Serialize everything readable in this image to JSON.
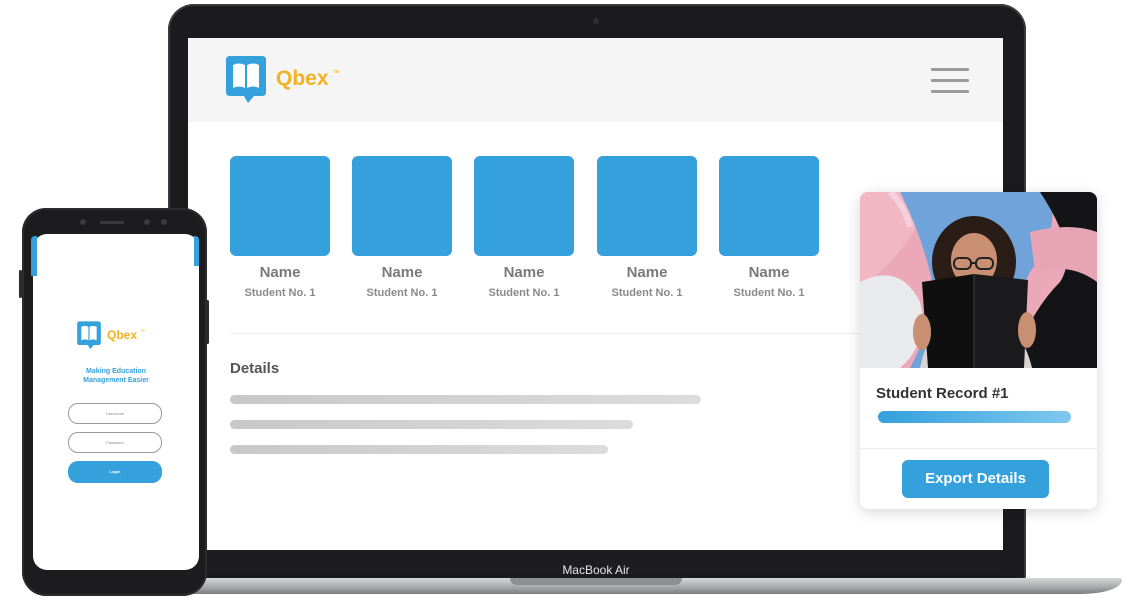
{
  "brand": {
    "name": "Qbex",
    "trademark": "™",
    "accent_color": "#34a0dc",
    "logo_color": "#f4b223",
    "logo_icon": "book-speech-bubble-icon"
  },
  "laptop": {
    "model_label": "MacBook Air",
    "header": {
      "menu_icon": "hamburger-menu-icon"
    },
    "students": [
      {
        "name": "Name",
        "number": "Student No. 1"
      },
      {
        "name": "Name",
        "number": "Student No. 1"
      },
      {
        "name": "Name",
        "number": "Student No. 1"
      },
      {
        "name": "Name",
        "number": "Student No. 1"
      },
      {
        "name": "Name",
        "number": "Student No. 1"
      }
    ],
    "details": {
      "title": "Details"
    }
  },
  "phone": {
    "tagline_line1": "Making Education",
    "tagline_line2": "Management Easier",
    "username_placeholder": "Username",
    "password_placeholder": "Password",
    "login_label": "Login"
  },
  "record_card": {
    "title": "Student Record #1",
    "progress": 1.0,
    "export_label": "Export Details"
  }
}
